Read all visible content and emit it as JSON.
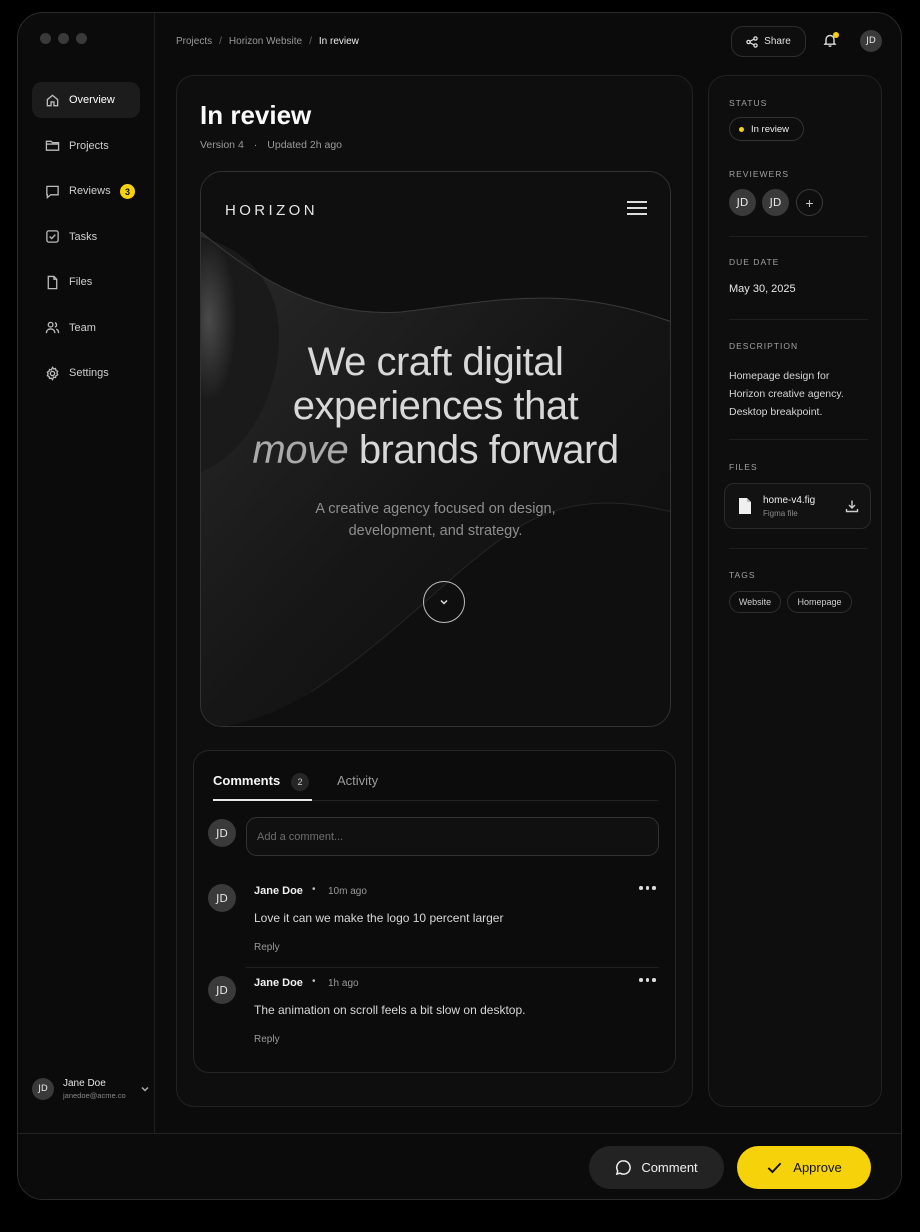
{
  "window": {
    "controls": [
      "close-dot",
      "minimize-dot",
      "maximize-dot"
    ]
  },
  "sidebar": {
    "items": [
      {
        "label": "Overview",
        "icon": "home-icon",
        "active": true
      },
      {
        "label": "Projects",
        "icon": "folder-icon"
      },
      {
        "label": "Reviews",
        "icon": "chat-icon",
        "badge": "3"
      },
      {
        "label": "Tasks",
        "icon": "checkbox-icon"
      },
      {
        "label": "Files",
        "icon": "file-icon"
      },
      {
        "label": "Team",
        "icon": "users-icon"
      },
      {
        "label": "Settings",
        "icon": "gear-icon"
      }
    ],
    "user": {
      "initials": "JD",
      "name": "Jane Doe",
      "email": "janedoe@acme.co"
    }
  },
  "header": {
    "breadcrumb": [
      "Projects",
      "Horizon Website",
      "In review"
    ],
    "share_label": "Share",
    "avatar_initials": "JD"
  },
  "main": {
    "title": "In review",
    "version": "Version 4",
    "updated": "Updated 2h ago",
    "preview": {
      "brand": "HORIZON",
      "headline_line1": "We craft digital",
      "headline_line2": "experiences that",
      "headline_em": "move",
      "headline_rest": "brands forward",
      "subtext": "A creative agency focused on design, development, and strategy."
    }
  },
  "comments": {
    "tabs": [
      {
        "label": "Comments",
        "count": "2",
        "active": true
      },
      {
        "label": "Activity"
      }
    ],
    "input_avatar": "JD",
    "placeholder": "Add a comment...",
    "items": [
      {
        "initials": "JD",
        "author": "Jane Doe",
        "time": "10m ago",
        "text": "Love it can we make the logo 10 percent larger",
        "reply": "Reply"
      },
      {
        "initials": "JD",
        "author": "Jane Doe",
        "time": "1h ago",
        "text": "The animation on scroll feels a bit slow on desktop.",
        "reply": "Reply"
      }
    ]
  },
  "details": {
    "status_label": "STATUS",
    "status_value": "In review",
    "reviewers_label": "REVIEWERS",
    "reviewers": [
      "JD",
      "JD"
    ],
    "add_reviewer": "+",
    "due_label": "DUE DATE",
    "due_value": "May 30, 2025",
    "description_label": "DESCRIPTION",
    "description": "Homepage design for Horizon creative agency. Desktop breakpoint.",
    "files_label": "FILES",
    "file": {
      "name": "home-v4.fig",
      "type": "Figma file"
    },
    "tags_label": "TAGS",
    "tags": [
      "Website",
      "Homepage"
    ]
  },
  "footer": {
    "comment_label": "Comment",
    "approve_label": "Approve"
  },
  "colors": {
    "accent": "#f5d20a",
    "background": "#0b0b0b",
    "panel": "#0e0e0e"
  }
}
